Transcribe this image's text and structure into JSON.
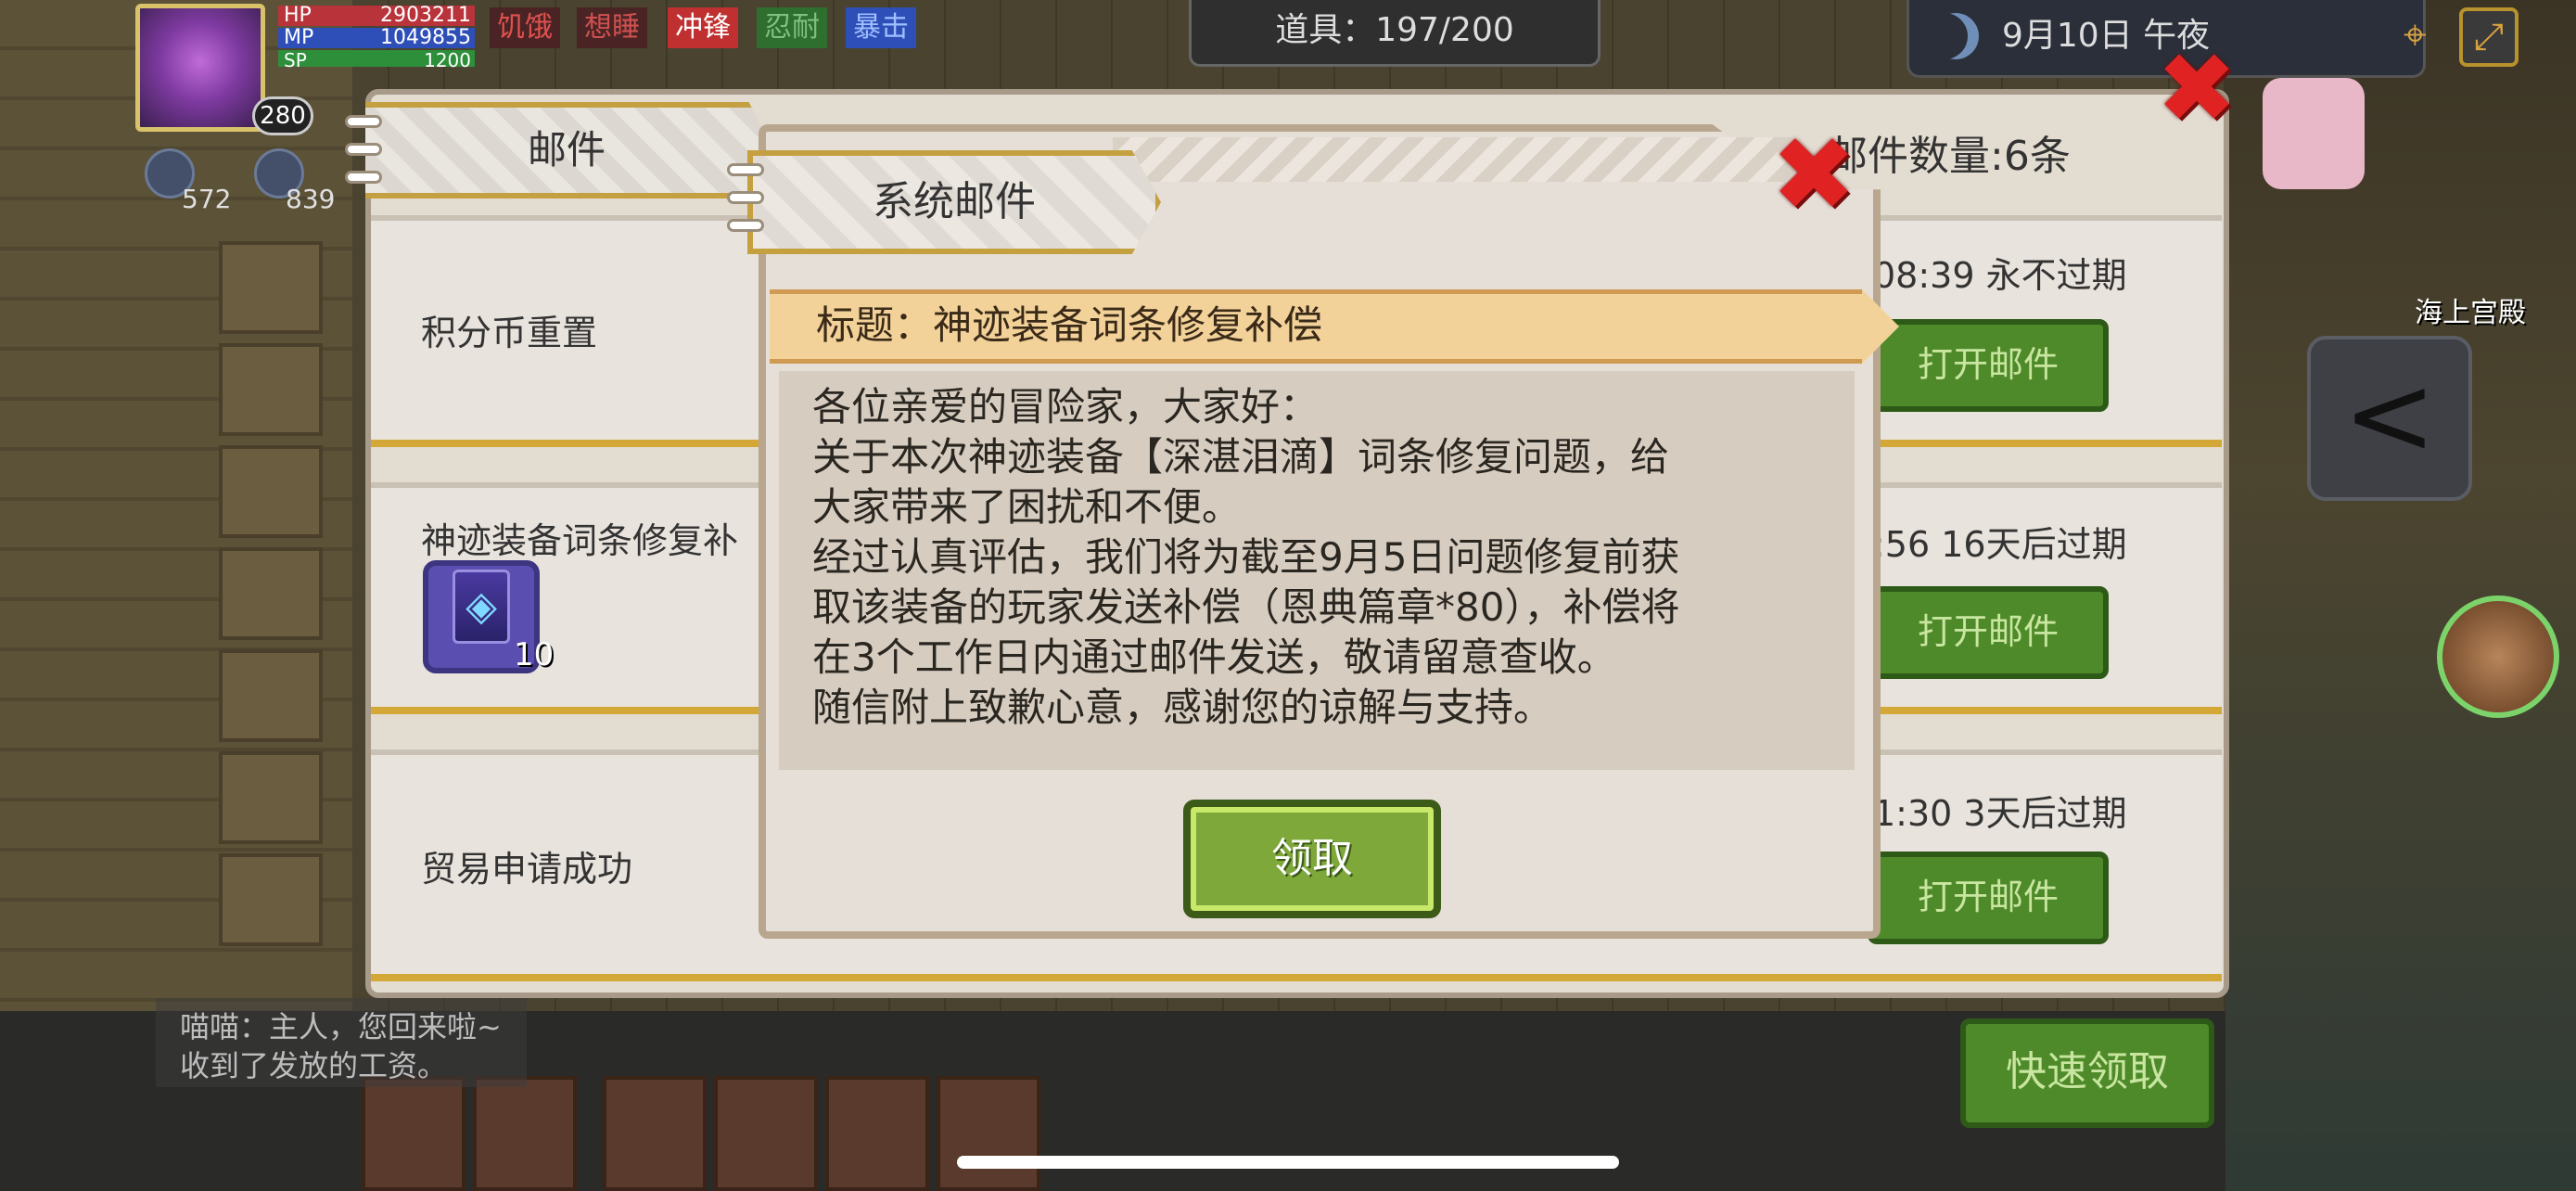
{
  "hud": {
    "hp_label": "HP",
    "hp_value": "2903211",
    "mp_label": "MP",
    "mp_value": "1049855",
    "sp_label": "SP",
    "sp_value": "1200",
    "level": "280",
    "status_tags": [
      {
        "label": "饥饿",
        "color": "#b8333a",
        "text_color": "#e05050"
      },
      {
        "label": "想睡",
        "color": "#6a2a2a",
        "text_color": "#d05050"
      },
      {
        "label": "冲锋",
        "color": "#c03030",
        "text_color": "#ffffff"
      },
      {
        "label": "忍耐",
        "color": "#3a8a3a",
        "text_color": "#7fc07f"
      },
      {
        "label": "暴击",
        "color": "#2f4fb8",
        "text_color": "#9fbfff"
      }
    ],
    "resource_1": "572",
    "resource_2": "839"
  },
  "top_bar": {
    "items_label": "道具：197/200",
    "date_time": "9月10日 午夜"
  },
  "mail_window": {
    "tab_label": "邮件",
    "mail_count": "邮件数量:6条",
    "mails": [
      {
        "title": "积分币重置",
        "expiry": "08:39  永不过期",
        "button": "打开邮件"
      },
      {
        "title": "神迹装备词条修复补",
        "expiry": ":56  16天后过期",
        "button": "打开邮件",
        "attachment_count": "10"
      },
      {
        "title": "贸易申请成功",
        "expiry": "1:30  3天后过期",
        "button": "打开邮件"
      }
    ]
  },
  "dialog": {
    "tab_label": "系统邮件",
    "subject": "标题：神迹装备词条修复补偿",
    "body": [
      "各位亲爱的冒险家，大家好：",
      "关于本次神迹装备【深湛泪滴】词条修复问题，给",
      "大家带来了困扰和不便。",
      "经过认真评估，我们将为截至9月5日问题修复前获",
      "取该装备的玩家发送补偿（恩典篇章*80），补偿将",
      "在3个工作日内通过邮件发送，敬请留意查收。",
      "随信附上致歉心意，感谢您的谅解与支持。"
    ],
    "claim_button": "领取"
  },
  "chat": {
    "line1": "喵喵：主人，您回来啦~",
    "line2": "收到了发放的工资。"
  },
  "quick_claim": "快速领取",
  "location": "海上宫殿",
  "icons": {
    "close": "close-icon",
    "moon": "moon-icon",
    "share": "share-icon",
    "gem": "gem-icon"
  }
}
